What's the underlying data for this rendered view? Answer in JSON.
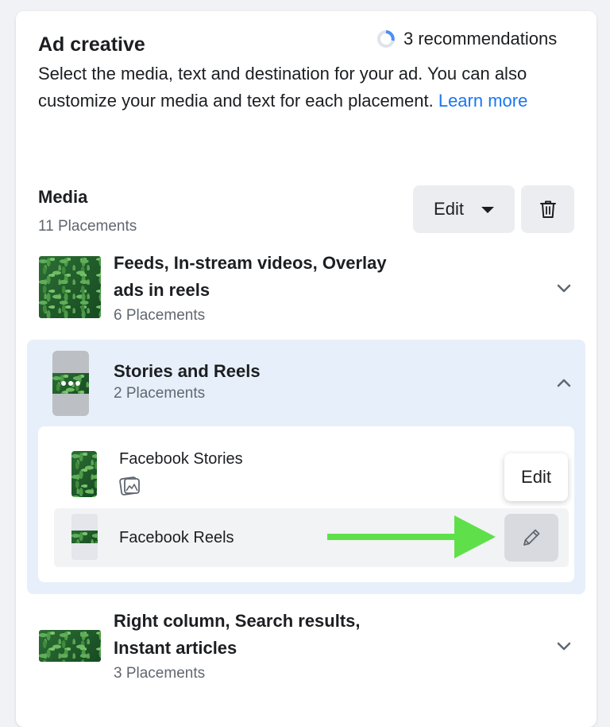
{
  "header": {
    "title": "Ad creative",
    "recommendations": "3 recommendations",
    "description": "Select the media, text and destination for your ad. You can also customize your media and text for each placement.",
    "learn_more": "Learn more"
  },
  "media": {
    "label": "Media",
    "count": "11 Placements",
    "edit_label": "Edit"
  },
  "groups": [
    {
      "title_line1": "Feeds, In-stream videos, Overlay",
      "title_line2": "ads in reels",
      "count": "6 Placements",
      "expanded": false
    },
    {
      "title": "Stories and Reels",
      "count": "2 Placements",
      "expanded": true,
      "items": [
        {
          "name": "Facebook Stories",
          "icon": "image-icon"
        },
        {
          "name": "Facebook Reels",
          "icon": "pencil-icon"
        }
      ]
    },
    {
      "title_line1": "Right column, Search results,",
      "title_line2": "Instant articles",
      "count": "3 Placements",
      "expanded": false
    }
  ],
  "tooltip": {
    "label": "Edit"
  },
  "colors": {
    "accent": "#1877f2",
    "expanded_bg": "#e7effa",
    "arrow": "#5fe04a"
  }
}
